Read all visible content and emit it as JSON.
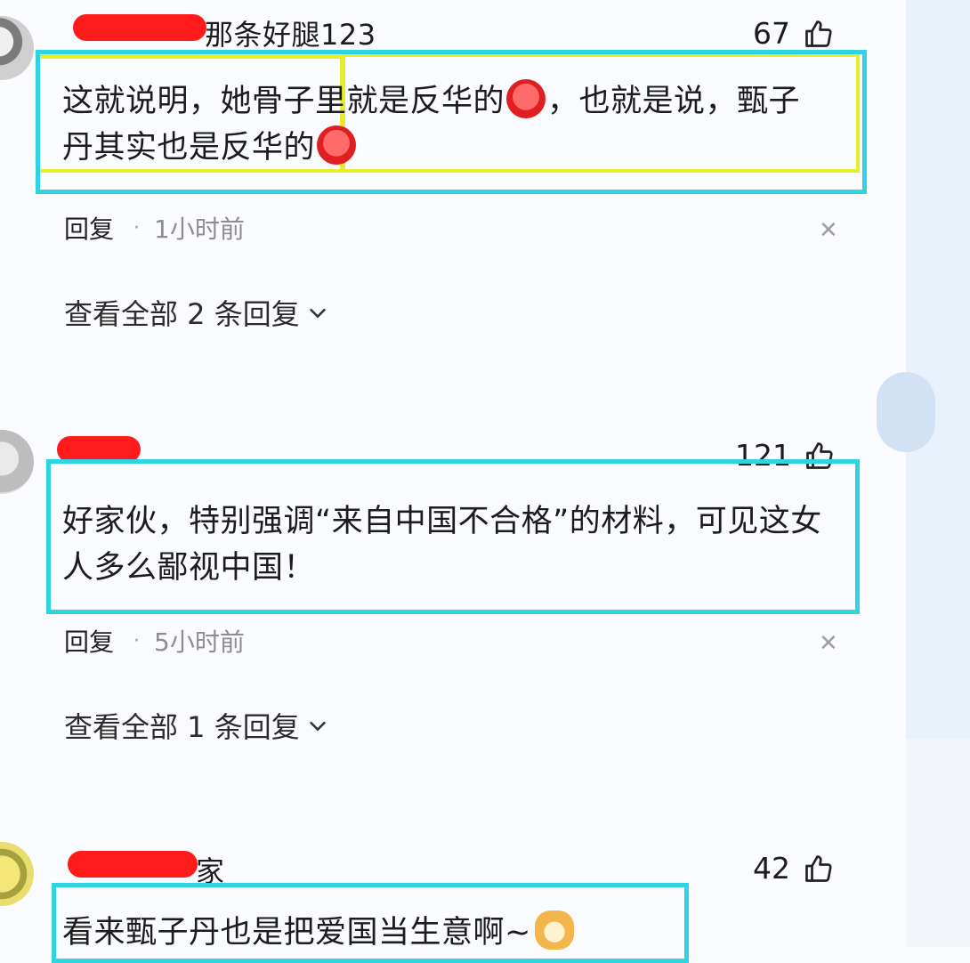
{
  "comments": [
    {
      "username_visible": "那条好腿123",
      "likes": "67",
      "text_lines": [
        "这就说明，她骨子里就是反华的",
        "，也就是说，甄子",
        "丹其实也是反华的"
      ],
      "emoji": "angry-face-emoji",
      "reply_label": "回复",
      "time": "1小时前",
      "view_more": "查看全部 2 条回复"
    },
    {
      "username_visible": "",
      "likes": "121",
      "text_lines": [
        "好家伙，特别强调“来自中国不合格”的材料，可见这女",
        "人多么鄙视中国！"
      ],
      "reply_label": "回复",
      "time": "5小时前",
      "view_more": "查看全部 1 条回复"
    },
    {
      "username_visible": "家",
      "likes": "42",
      "text_lines": [
        "看来甄子丹也是把爱国当生意啊~"
      ],
      "emoji": "dog-face-emoji"
    }
  ],
  "icons": {
    "like": "thumbs-up-icon",
    "close": "close-icon",
    "expand": "chevron-down-icon"
  },
  "colors": {
    "highlight_cyan": "#2fd4e2",
    "highlight_yellow": "#e4ef2a",
    "redaction": "#ff1b1b"
  }
}
